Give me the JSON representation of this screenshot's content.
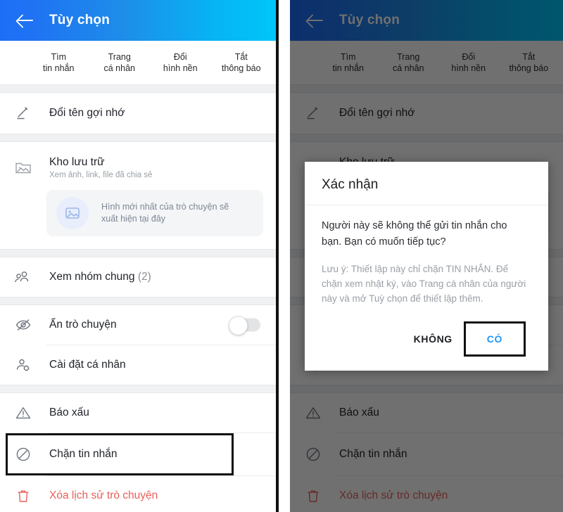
{
  "appbar": {
    "title": "Tùy chọn",
    "back_icon": "arrow-left-icon"
  },
  "tabs": [
    {
      "line1": "Tìm",
      "line2": "tin nhắn"
    },
    {
      "line1": "Trang",
      "line2": "cá nhân"
    },
    {
      "line1": "Đổi",
      "line2": "hình nền"
    },
    {
      "line1": "Tắt",
      "line2": "thông báo"
    }
  ],
  "menu": {
    "rename": {
      "label": "Đổi tên gợi nhớ",
      "icon": "pencil-icon"
    },
    "archive": {
      "label": "Kho lưu trữ",
      "sub": "Xem ảnh, link, file đã chia sẻ",
      "icon": "folder-image-icon",
      "placeholder": {
        "icon": "image-icon",
        "line1": "Hình mới nhất của trò chuyện sẽ",
        "line2": "xuất hiện tại đây"
      }
    },
    "groups": {
      "label": "Xem nhóm chung",
      "count": "(2)",
      "icon": "people-icon"
    },
    "hide_chat": {
      "label": "Ẩn trò chuyện",
      "icon": "eye-off-icon",
      "toggle_state": "off"
    },
    "personal_settings": {
      "label": "Cài đặt cá nhân",
      "icon": "user-gear-icon"
    },
    "report": {
      "label": "Báo xấu",
      "icon": "warning-triangle-icon"
    },
    "block": {
      "label": "Chặn tin nhắn",
      "icon": "block-circle-icon",
      "highlighted": "true"
    },
    "delete_history": {
      "label": "Xóa lịch sử trò chuyện",
      "icon": "trash-icon"
    }
  },
  "dialog": {
    "title": "Xác nhận",
    "message_line1": "Người này sẽ không thể gửi tin nhắn cho",
    "message_line2": "bạn. Bạn có muốn tiếp tục?",
    "note": "Lưu ý: Thiết lập này chỉ chặn TIN NHẮN. Để chặn xem nhật ký, vào Trang cá nhân của người này và mở Tuỳ chọn để thiết lập thêm.",
    "button_no": "KHÔNG",
    "button_yes": "CÓ"
  },
  "colors": {
    "header_gradient_start": "#1d6ef6",
    "header_gradient_end": "#00c6f9",
    "danger": "#e8605a",
    "accent_blue": "#2196f3",
    "highlight_box": "#111111",
    "dim_overlay": "rgba(0,0,0,0.56)"
  }
}
